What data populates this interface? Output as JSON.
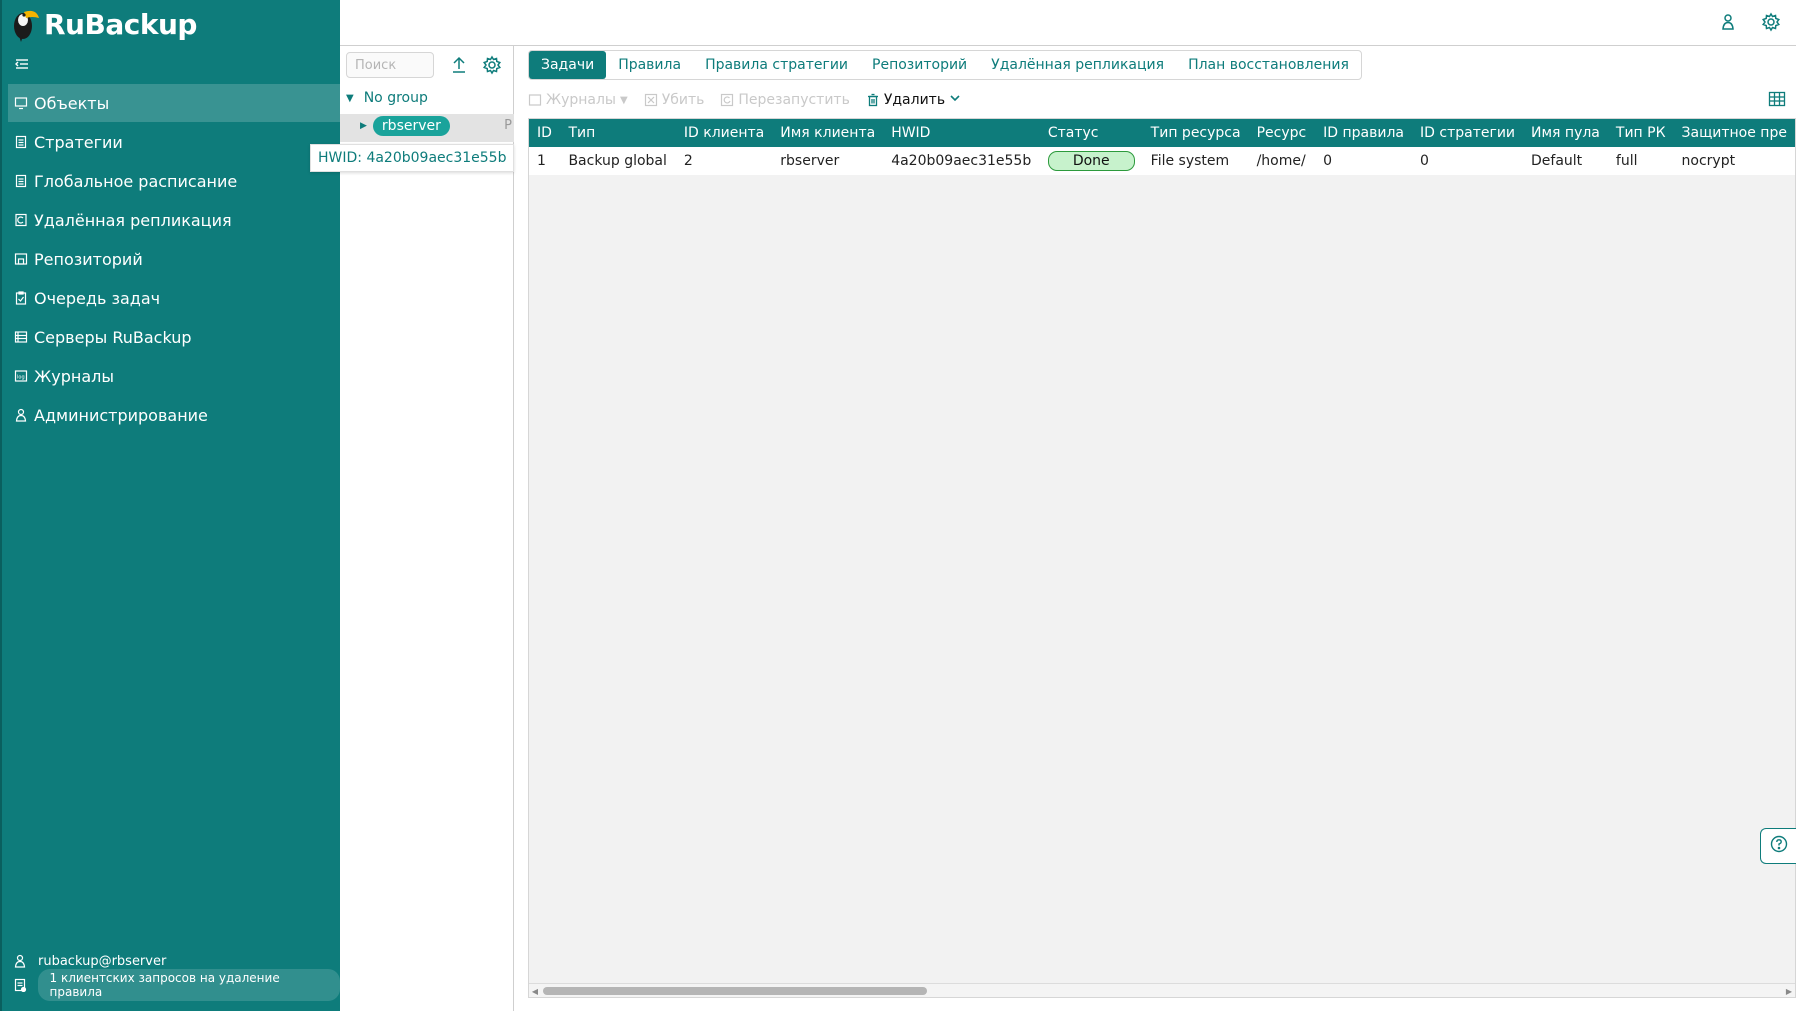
{
  "app": {
    "brand": "RuBackup",
    "colors": {
      "primary": "#0e7c7b",
      "status_done_bg": "#c7f2cc",
      "status_done_border": "#2c9a3c"
    }
  },
  "sidebar": {
    "items": [
      {
        "label": "Объекты",
        "icon": "monitor-icon",
        "active": true
      },
      {
        "label": "Стратегии",
        "icon": "document-icon"
      },
      {
        "label": "Глобальное расписание",
        "icon": "document-icon"
      },
      {
        "label": "Удалённая репликация",
        "icon": "replication-icon"
      },
      {
        "label": "Репозиторий",
        "icon": "repository-icon"
      },
      {
        "label": "Очередь задач",
        "icon": "clipboard-icon"
      },
      {
        "label": "Серверы RuBackup",
        "icon": "server-icon"
      },
      {
        "label": "Журналы",
        "icon": "log-icon"
      },
      {
        "label": "Администрирование",
        "icon": "admin-icon"
      }
    ],
    "footer": {
      "user": "rubackup@rbserver",
      "notice": "1 клиентских запросов на удаление правила"
    }
  },
  "tree": {
    "search_placeholder": "Поиск",
    "group": "No group",
    "node": "rbserver",
    "node_extra": "P",
    "tooltip": "HWID: 4a20b09aec31e55b"
  },
  "tabs": [
    {
      "label": "Задачи",
      "active": true
    },
    {
      "label": "Правила"
    },
    {
      "label": "Правила стратегии"
    },
    {
      "label": "Репозиторий"
    },
    {
      "label": "Удалённая репликация"
    },
    {
      "label": "План восстановления"
    }
  ],
  "toolbar": {
    "logs": "Журналы",
    "kill": "Убить",
    "restart": "Перезапустить",
    "delete": "Удалить"
  },
  "table": {
    "columns": [
      "ID",
      "Тип",
      "ID клиента",
      "Имя клиента",
      "HWID",
      "Статус",
      "Тип ресурса",
      "Ресурс",
      "ID правила",
      "ID стратегии",
      "Имя пула",
      "Тип РК",
      "Защитное пре"
    ],
    "rows": [
      [
        "1",
        "Backup global",
        "2",
        "rbserver",
        "4a20b09aec31e55b",
        "Done",
        "File system",
        "/home/",
        "0",
        "0",
        "Default",
        "full",
        "nocrypt"
      ]
    ]
  }
}
